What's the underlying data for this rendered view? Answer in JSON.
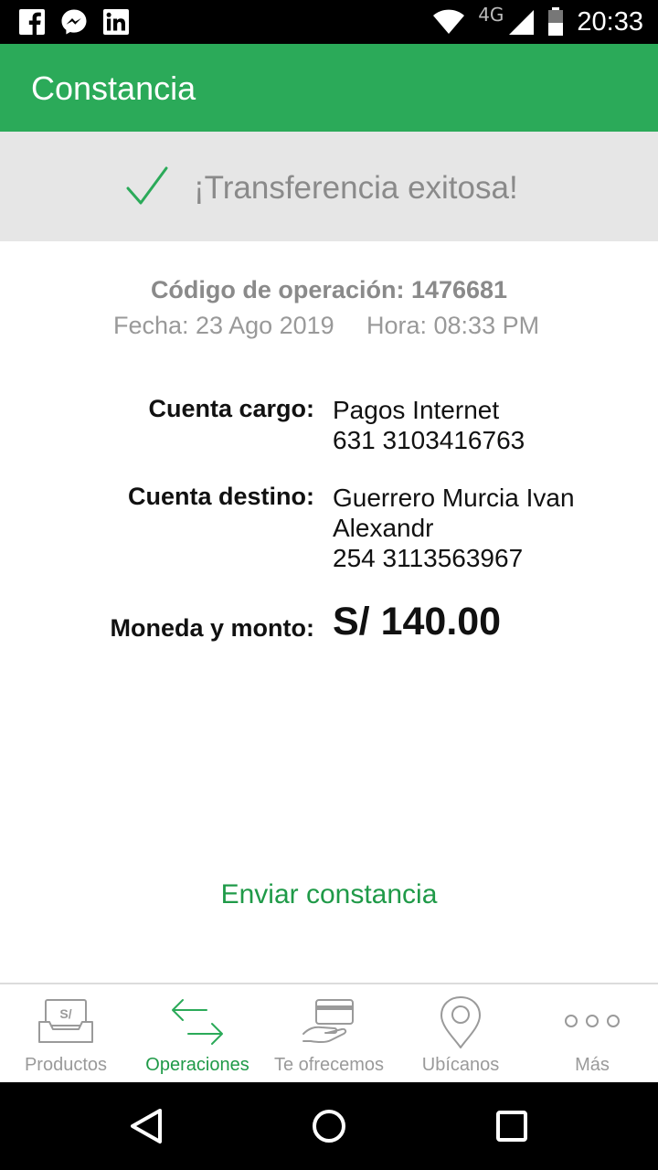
{
  "status_bar": {
    "notification_icons": [
      "facebook-icon",
      "messenger-icon",
      "linkedin-icon"
    ],
    "network_type": "4G",
    "time": "20:33"
  },
  "app_bar": {
    "title": "Constancia"
  },
  "banner": {
    "icon": "check-icon",
    "message": "¡Transferencia exitosa!"
  },
  "operation": {
    "code": "Código de operación: 1476681",
    "date": "Fecha: 23 Ago 2019",
    "time": "Hora: 08:33 PM"
  },
  "details": {
    "cargo_label": "Cuenta cargo:",
    "cargo_name": "Pagos Internet",
    "cargo_number": "631 3103416763",
    "destino_label": "Cuenta destino:",
    "destino_name_1": "Guerrero Murcia Ivan",
    "destino_name_2": "Alexandr",
    "destino_number": "254 3113563967",
    "monto_label": "Moneda y monto:",
    "monto_value": "S/ 140.00"
  },
  "actions": {
    "send_receipt": "Enviar constancia"
  },
  "bottom_nav": {
    "items": [
      {
        "label": "Productos",
        "icon": "tray-money-icon",
        "active": false
      },
      {
        "label": "Operaciones",
        "icon": "transfer-arrows-icon",
        "active": true
      },
      {
        "label": "Te ofrecemos",
        "icon": "hand-card-icon",
        "active": false
      },
      {
        "label": "Ubícanos",
        "icon": "location-pin-icon",
        "active": false
      },
      {
        "label": "Más",
        "icon": "more-dots-icon",
        "active": false
      }
    ]
  },
  "colors": {
    "primary_green": "#2baa59",
    "link_green": "#1f9a48",
    "banner_gray": "#e6e6e6"
  }
}
